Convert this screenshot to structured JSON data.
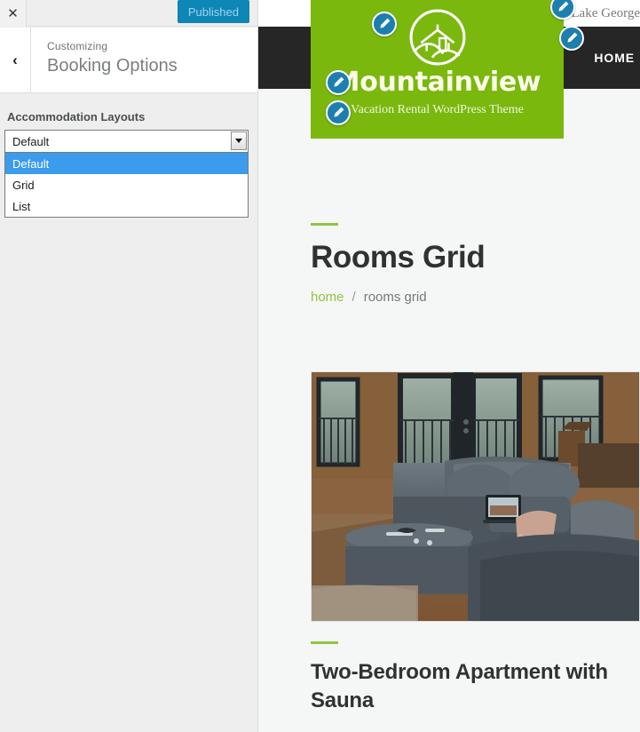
{
  "customizer": {
    "close_icon": "close-x-icon",
    "publish_label": "Published",
    "back_icon": "chevron-left-icon",
    "subtitle": "Customizing",
    "title": "Booking Options",
    "control": {
      "label": "Accommodation Layouts",
      "selected": "Default",
      "options": [
        {
          "label": "Default",
          "selected": true
        },
        {
          "label": "Grid",
          "selected": false
        },
        {
          "label": "List",
          "selected": false
        }
      ],
      "arrow_icon": "chevron-down-icon"
    },
    "colors": {
      "publish_bg": "#0e86b6",
      "panel_bg": "#eeeeee",
      "option_highlight": "#3b9bec"
    }
  },
  "preview": {
    "topbar": {
      "contact": "Lake George"
    },
    "nav": {
      "items": [
        {
          "label": "HOME"
        }
      ]
    },
    "logo": {
      "mark_icon": "mountain-house-logo-icon",
      "name": "Mountainview",
      "tagline": "Vacation Rental WordPress Theme",
      "bg_color": "#7ab80e"
    },
    "page": {
      "title": "Rooms Grid",
      "breadcrumb": {
        "home": "home",
        "separator": "/",
        "current": "rooms grid"
      },
      "accent_color": "#8dc63f"
    },
    "room": {
      "photo_alt": "cabin-living-room-photo",
      "title": "Two-Bedroom Apartment with Sauna"
    },
    "edit_pins": [
      {
        "name": "edit-pin-contact-info"
      },
      {
        "name": "edit-pin-nav-menu"
      },
      {
        "name": "edit-pin-site-icon"
      },
      {
        "name": "edit-pin-site-title"
      },
      {
        "name": "edit-pin-tagline"
      }
    ]
  }
}
